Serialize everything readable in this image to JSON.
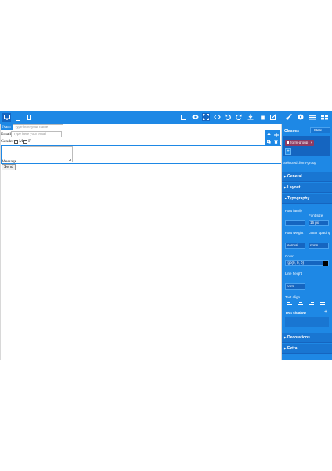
{
  "colors": {
    "accent": "#1e88e5",
    "panel_dark": "#1565c0",
    "tag": "#8e3b62",
    "white": "#ffffff"
  },
  "toolbar": {
    "devices": [
      "desktop-icon",
      "tablet-icon",
      "mobile-icon"
    ],
    "tools": [
      "square-outline-icon",
      "eye-icon",
      "fullscreen-icon",
      "code-icon",
      "undo-icon",
      "redo-icon",
      "download-icon",
      "trash-icon",
      "edit-icon",
      "paintbrush-icon",
      "gear-icon",
      "layers-icon",
      "blocks-icon"
    ]
  },
  "canvas": {
    "form": {
      "name_label": "Nam",
      "name_placeholder": "Type here your name",
      "email_label": "Email",
      "email_placeholder": "Type here your email",
      "gender_label": "Gender",
      "gender_m": "M",
      "gender_f": "F",
      "message_label": "Message",
      "send_label": "Send"
    }
  },
  "panel": {
    "classes_label": "Classes",
    "state_value": "- State -",
    "tag_label": "form-group",
    "tag_close": "×",
    "add_label": "+",
    "selected_text": "Selected .form-group",
    "sectors": {
      "general": "General",
      "layout": "Layout",
      "typography": "Typography",
      "decorations": "Decorations",
      "extra": "Extra"
    },
    "typography": {
      "font_family_label": "Font family",
      "font_size_label": "Font size",
      "font_size_value": "16 px",
      "font_weight_label": "Font weight",
      "font_weight_value": "Normal",
      "letter_spacing_label": "Letter spacing",
      "letter_spacing_value": "norm",
      "color_label": "Color",
      "color_value": "rgb(0, 0, 0)",
      "line_height_label": "Line height",
      "line_height_value": "norm",
      "text_align_label": "Text align",
      "text_shadow_label": "Text shadow",
      "text_shadow_add": "+"
    }
  }
}
